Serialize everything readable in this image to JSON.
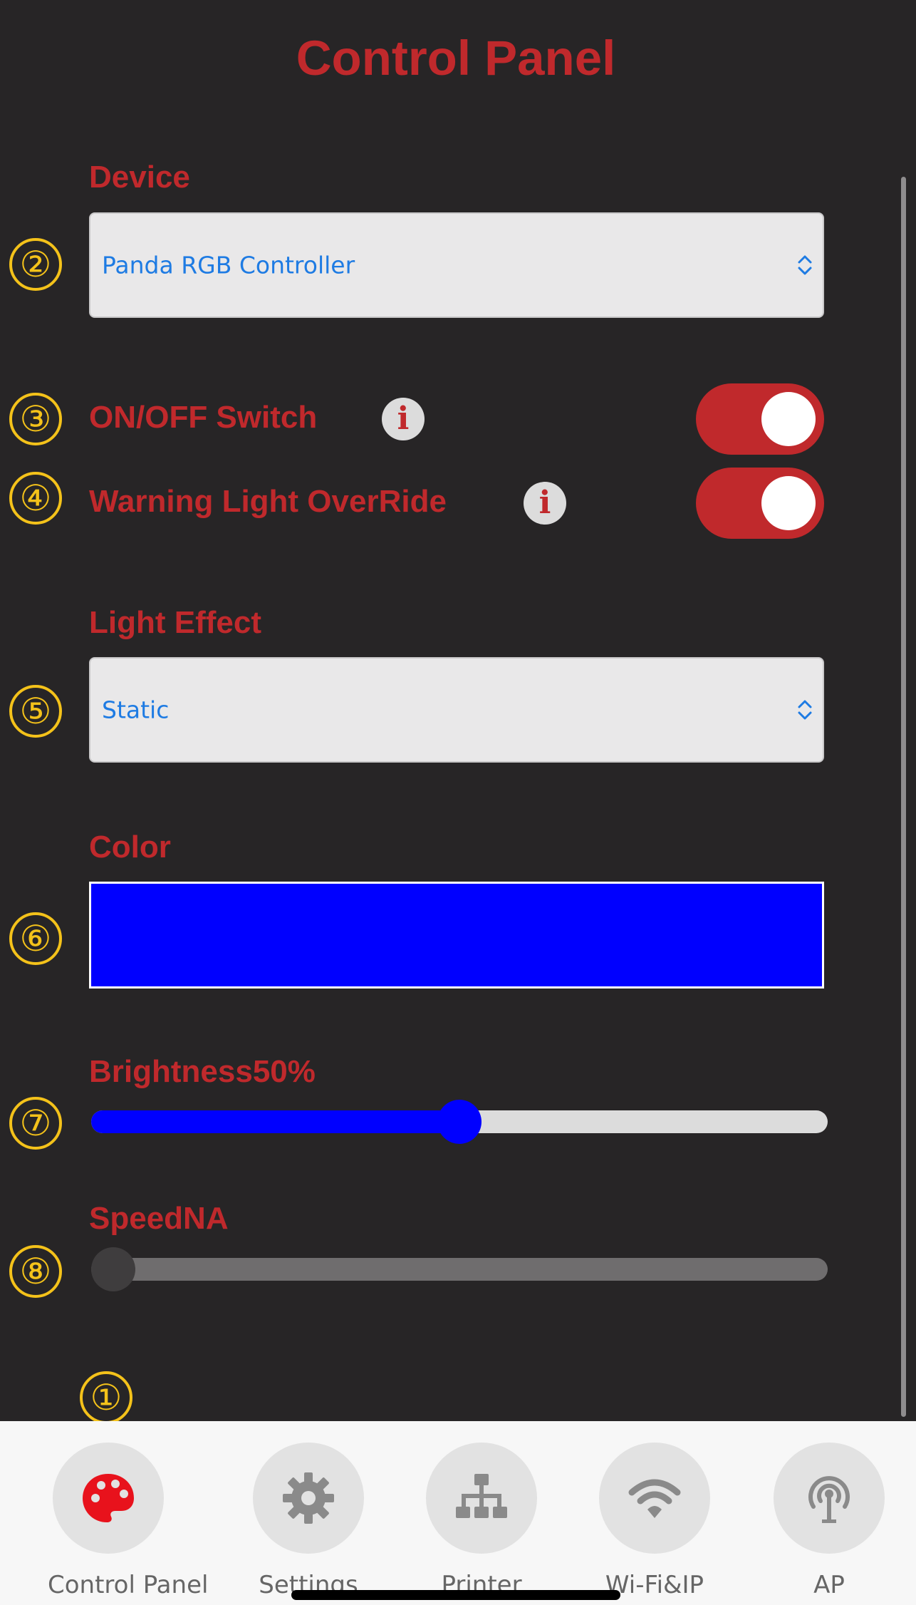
{
  "page_title": "Control Panel",
  "markers": {
    "m1": "①",
    "m2": "②",
    "m3": "③",
    "m4": "④",
    "m5": "⑤",
    "m6": "⑥",
    "m7": "⑦",
    "m8": "⑧"
  },
  "device": {
    "label": "Device",
    "value": "Panda RGB Controller"
  },
  "on_off": {
    "label": "ON/OFF Switch",
    "info": "i",
    "on": true
  },
  "warning_override": {
    "label": "Warning Light OverRide",
    "info": "i",
    "on": true
  },
  "light_effect": {
    "label": "Light Effect",
    "value": "Static"
  },
  "color": {
    "label": "Color",
    "value": "#0000ff"
  },
  "brightness": {
    "label": "Brightness50%",
    "level": 0.5
  },
  "speed": {
    "label": "SpeedNA",
    "level": 0.0
  },
  "colors": {
    "accent": "#c0292c",
    "background": "#272526",
    "marker": "#f4c21a",
    "slider_active": "#0000ff"
  },
  "tabs": [
    {
      "label": "Control Panel",
      "icon": "palette-icon",
      "active": true
    },
    {
      "label": "Settings",
      "icon": "gear-icon",
      "active": false
    },
    {
      "label": "Printer",
      "icon": "network-icon",
      "active": false
    },
    {
      "label": "Wi-Fi&IP",
      "icon": "wifi-icon",
      "active": false
    },
    {
      "label": "AP",
      "icon": "access-point-icon",
      "active": false
    }
  ]
}
